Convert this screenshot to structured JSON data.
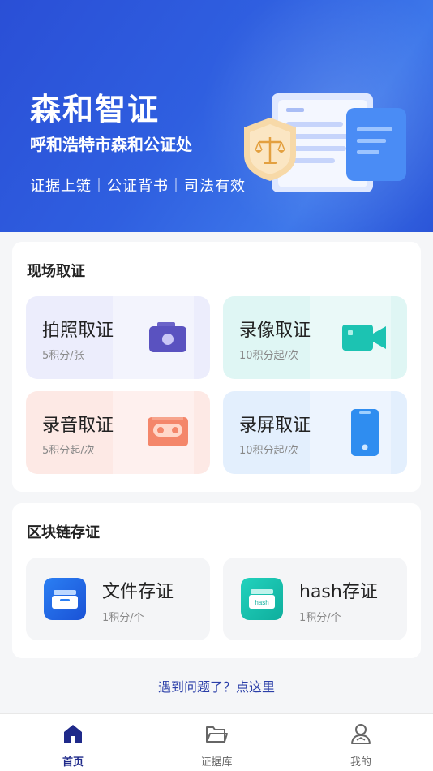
{
  "hero": {
    "title": "森和智证",
    "subtitle": "呼和浩特市森和公证处",
    "tagline": "证据上链｜公证背书｜司法有效"
  },
  "onsite": {
    "title": "现场取证",
    "tiles": [
      {
        "label": "拍照取证",
        "sub": "5积分/张",
        "icon": "camera-icon"
      },
      {
        "label": "录像取证",
        "sub": "10积分起/次",
        "icon": "video-camera-icon"
      },
      {
        "label": "录音取证",
        "sub": "5积分起/次",
        "icon": "cassette-icon"
      },
      {
        "label": "录屏取证",
        "sub": "10积分起/次",
        "icon": "phone-icon"
      }
    ]
  },
  "blockchain": {
    "title": "区块链存证",
    "tiles": [
      {
        "label": "文件存证",
        "sub": "1积分/个",
        "icon": "file-tray-icon"
      },
      {
        "label": "hash存证",
        "sub": "1积分/个",
        "icon": "hash-tray-icon",
        "icon_text": "hash"
      }
    ]
  },
  "help": {
    "text": "遇到问题了？点这里"
  },
  "tabbar": {
    "items": [
      {
        "label": "首页",
        "icon": "home-icon",
        "active": true
      },
      {
        "label": "证据库",
        "icon": "folder-icon",
        "active": false
      },
      {
        "label": "我的",
        "icon": "user-icon",
        "active": false
      }
    ]
  },
  "colors": {
    "brand": "#2f5fe0",
    "active_tab": "#1f2a8a",
    "link": "#2b3fa8"
  }
}
